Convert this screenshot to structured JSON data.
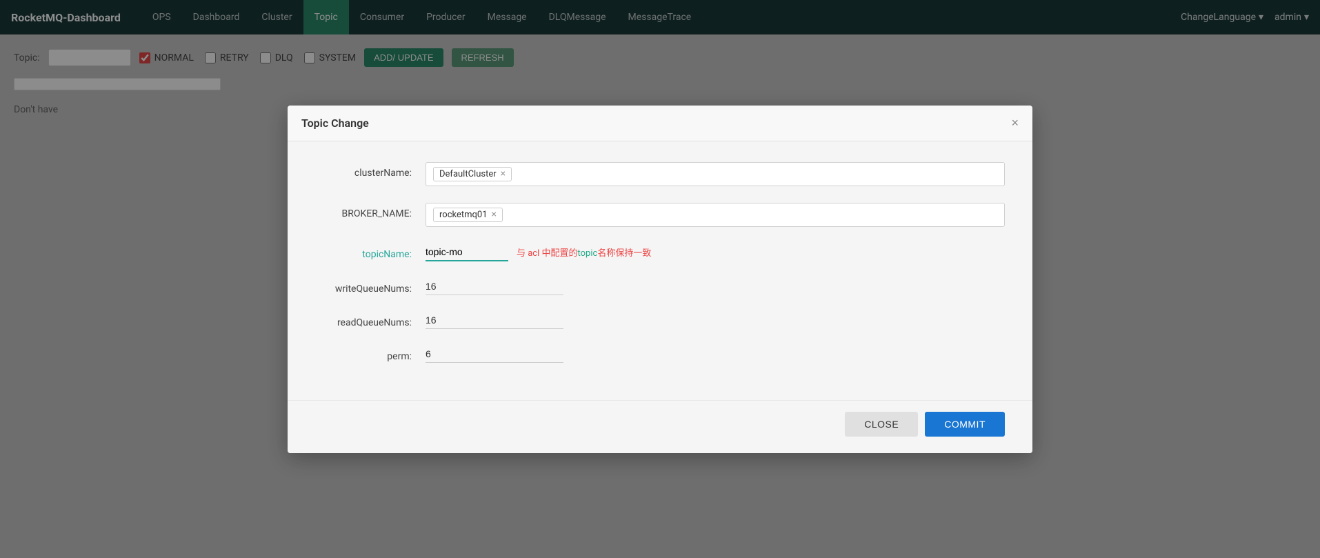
{
  "navbar": {
    "brand": "RocketMQ-Dashboard",
    "ops_label": "OPS",
    "nav_items": [
      {
        "label": "Dashboard",
        "active": false
      },
      {
        "label": "Cluster",
        "active": false
      },
      {
        "label": "Topic",
        "active": true
      },
      {
        "label": "Consumer",
        "active": false
      },
      {
        "label": "Producer",
        "active": false
      },
      {
        "label": "Message",
        "active": false
      },
      {
        "label": "DLQMessage",
        "active": false
      },
      {
        "label": "MessageTrace",
        "active": false
      }
    ],
    "change_language": "ChangeLanguage",
    "admin": "admin"
  },
  "filter": {
    "topic_label": "Topic:",
    "normal_label": "NORMAL",
    "retry_label": "RETRY",
    "dlq_label": "DLQ",
    "system_label": "SYSTEM",
    "add_update_label": "ADD/ UPDATE",
    "refresh_label": "REFRESH"
  },
  "table": {
    "dont_have": "Don't have"
  },
  "modal": {
    "title": "Topic Change",
    "close_x": "×",
    "cluster_name_label": "clusterName:",
    "cluster_tag": "DefaultCluster",
    "broker_name_label": "BROKER_NAME:",
    "broker_tag": "rocketmq01",
    "topic_name_label": "topicName:",
    "topic_name_placeholder": "topic-mo",
    "topic_name_hint_pre": "与 acl 中配置的",
    "topic_name_hint_mid": "topic",
    "topic_name_hint_post": "名称保持一致",
    "write_queue_label": "writeQueueNums:",
    "write_queue_value": "16",
    "read_queue_label": "readQueueNums:",
    "read_queue_value": "16",
    "perm_label": "perm:",
    "perm_value": "6",
    "close_button": "CLOSE",
    "commit_button": "COMMIT"
  }
}
